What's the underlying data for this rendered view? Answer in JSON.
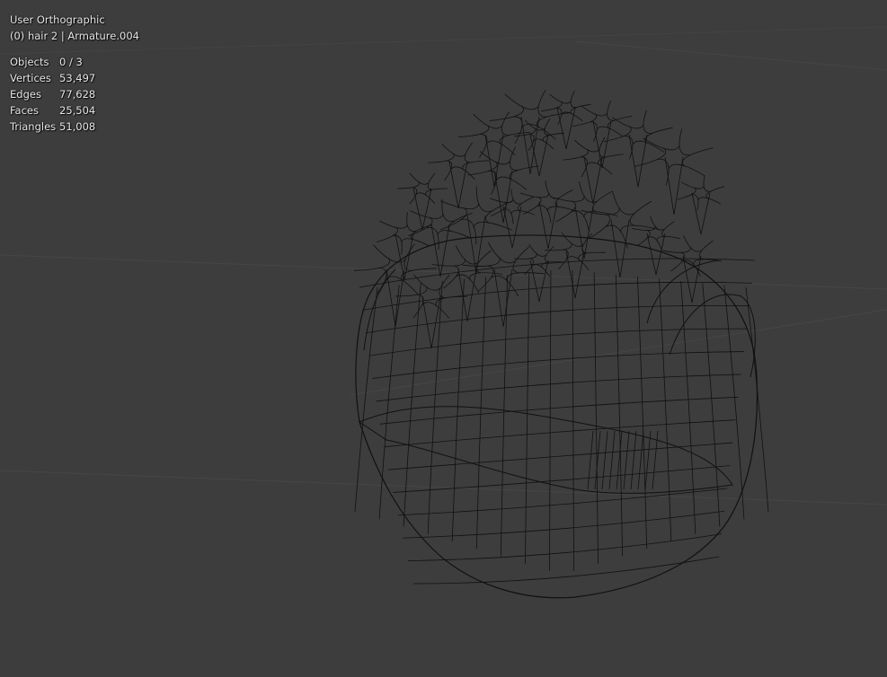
{
  "viewport": {
    "view_name": "User Orthographic",
    "object_info": "(0) hair 2 | Armature.004",
    "background_color": "#3d3d3d",
    "wire_color": "#111111",
    "grid_color": "#4a4a4a"
  },
  "stats": [
    {
      "label": "Objects",
      "value": "0 / 3"
    },
    {
      "label": "Vertices",
      "value": "53,497"
    },
    {
      "label": "Edges",
      "value": "77,628"
    },
    {
      "label": "Faces",
      "value": "25,504"
    },
    {
      "label": "Triangles",
      "value": "51,008"
    }
  ]
}
